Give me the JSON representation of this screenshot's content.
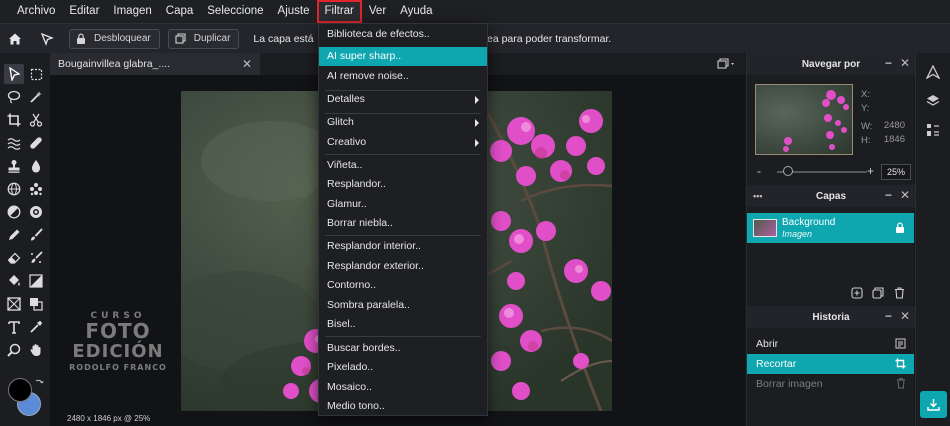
{
  "menubar": {
    "items": [
      "Archivo",
      "Editar",
      "Imagen",
      "Capa",
      "Seleccione",
      "Ajuste",
      "Filtrar",
      "Ver",
      "Ayuda"
    ],
    "active": "Filtrar"
  },
  "toolbar": {
    "unlock_label": "Desbloquear",
    "duplicate_label": "Duplicar",
    "message_left": "La capa está",
    "message_right": "ea para poder transformar."
  },
  "document": {
    "tab_title": "Bougainvillea glabra_....",
    "status": "2480 x 1846 px @ 25%",
    "watermark": [
      "CURSO",
      "FOTO",
      "EDICIÓN",
      "RODOLFO FRANCO"
    ]
  },
  "filter_menu": {
    "items": [
      {
        "label": "Biblioteca de efectos.."
      },
      {
        "label": "AI super sharp..",
        "highlighted": true
      },
      {
        "label": "AI remove noise.."
      },
      {
        "label": "Detalles",
        "submenu": true
      },
      {
        "label": "Glitch",
        "submenu": true
      },
      {
        "label": "Creativo",
        "submenu": true
      },
      {
        "label": "Viñeta.."
      },
      {
        "label": "Resplandor.."
      },
      {
        "label": "Glamur.."
      },
      {
        "label": "Borrar niebla.."
      },
      {
        "label": "Resplandor interior.."
      },
      {
        "label": "Resplandor exterior.."
      },
      {
        "label": "Contorno.."
      },
      {
        "label": "Sombra paralela.."
      },
      {
        "label": "Bisel.."
      },
      {
        "label": "Buscar bordes.."
      },
      {
        "label": "Pixelado.."
      },
      {
        "label": "Mosaico.."
      },
      {
        "label": "Medio tono.."
      }
    ]
  },
  "navigator": {
    "title": "Navegar por",
    "x_label": "X:",
    "y_label": "Y:",
    "w_label": "W:",
    "h_label": "H:",
    "w_value": "2480",
    "h_value": "1846",
    "zoom": "25%",
    "minus": "-",
    "plus": "+"
  },
  "layers": {
    "title": "Capas",
    "dots": "•••",
    "layer_name": "Background",
    "layer_type": "Imagen"
  },
  "history": {
    "title": "Historia",
    "items": [
      {
        "label": "Abrir"
      },
      {
        "label": "Recortar",
        "selected": true
      },
      {
        "label": "Borrar imagen",
        "dim": true
      }
    ]
  },
  "colors": {
    "accent": "#0ea7b0",
    "highlight_border": "#e0252b",
    "foreground": "#000000",
    "background": "#5b8bd6"
  }
}
